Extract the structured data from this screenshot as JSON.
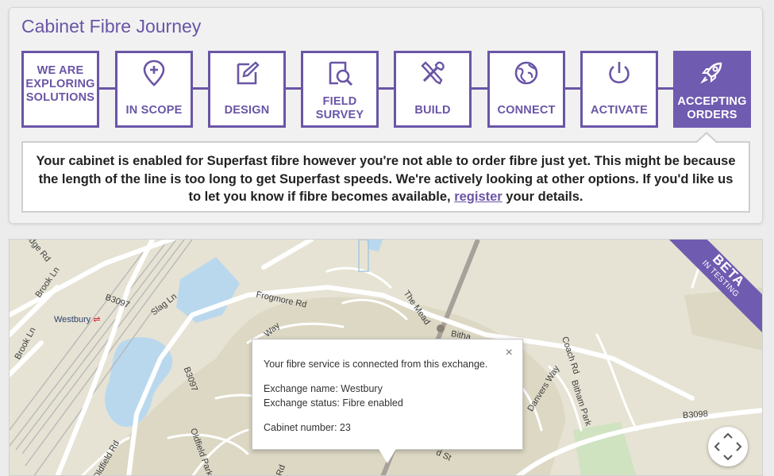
{
  "panel": {
    "title": "Cabinet Fibre Journey",
    "accent_color": "#6a55a6"
  },
  "steps": [
    {
      "label": "WE ARE EXPLORING SOLUTIONS",
      "icon": "none",
      "active": false
    },
    {
      "label": "IN SCOPE",
      "icon": "location-plus-icon",
      "active": false
    },
    {
      "label": "DESIGN",
      "icon": "pencil-icon",
      "active": false
    },
    {
      "label": "FIELD SURVEY",
      "icon": "magnifier-document-icon",
      "active": false
    },
    {
      "label": "BUILD",
      "icon": "tools-icon",
      "active": false
    },
    {
      "label": "CONNECT",
      "icon": "globe-icon",
      "active": false
    },
    {
      "label": "ACTIVATE",
      "icon": "power-icon",
      "active": false
    },
    {
      "label": "ACCEPTING ORDERS",
      "icon": "rocket-icon",
      "active": true
    }
  ],
  "message": {
    "text_before": "Your cabinet is enabled for Superfast fibre however you're not able to order fibre just yet. This might be because the length of the line is too long to get Superfast speeds. We're actively looking at other options. If you'd like us to let you know if fibre becomes available, ",
    "link": "register",
    "text_after": " your details."
  },
  "map": {
    "labels": {
      "ridge_rd": "idge Rd",
      "brook_ln1": "Brook Ln",
      "brook_ln2": "Brook Ln",
      "b3097a": "B3097",
      "b3097b": "B3097",
      "westbury": "Westbury",
      "slag_ln": "Slag Ln",
      "frogmore_rd": "Frogmore Rd",
      "way": "Way",
      "the_mead": "The Mead",
      "bitham": "Bitha",
      "coach_rd": "Coach Rd",
      "danvers_way": "Danvers Way",
      "bitham_park": "Bitham Park",
      "b3098": "B3098",
      "oldfield_rd": "Oldfield Rd",
      "oldfield_park": "Oldfield Park",
      "st": "d St",
      "rd": "Rd"
    },
    "badge": {
      "line1": "BETA",
      "line2": "IN TESTING"
    },
    "popup": {
      "intro": "Your fibre service is connected from this exchange.",
      "exchange_name": "Exchange name: Westbury",
      "exchange_status": "Exchange status: Fibre enabled",
      "cabinet_number": "Cabinet number: 23",
      "close": "×"
    }
  }
}
